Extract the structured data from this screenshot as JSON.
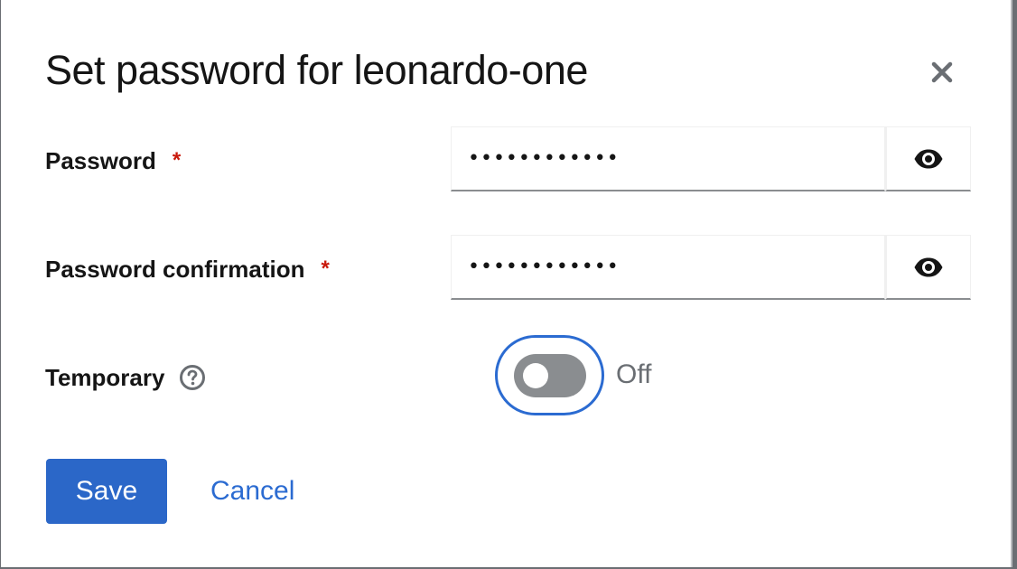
{
  "modal": {
    "title": "Set password for leonardo-one",
    "close_icon": "close-icon"
  },
  "form": {
    "password": {
      "label": "Password",
      "required_mark": "*",
      "value": "••••••••••••",
      "toggle_icon": "eye-icon"
    },
    "password_confirmation": {
      "label": "Password confirmation",
      "required_mark": "*",
      "value": "••••••••••••",
      "toggle_icon": "eye-icon"
    },
    "temporary": {
      "label": "Temporary",
      "help_icon": "help-circle-icon",
      "switch_state": "Off",
      "checked": false
    }
  },
  "actions": {
    "save_label": "Save",
    "cancel_label": "Cancel"
  },
  "colors": {
    "primary": "#2b67c8",
    "link": "#2b6bd1",
    "required": "#c9190b",
    "switch_off": "#8a8d90",
    "focus_ring": "#2b6bd1"
  }
}
